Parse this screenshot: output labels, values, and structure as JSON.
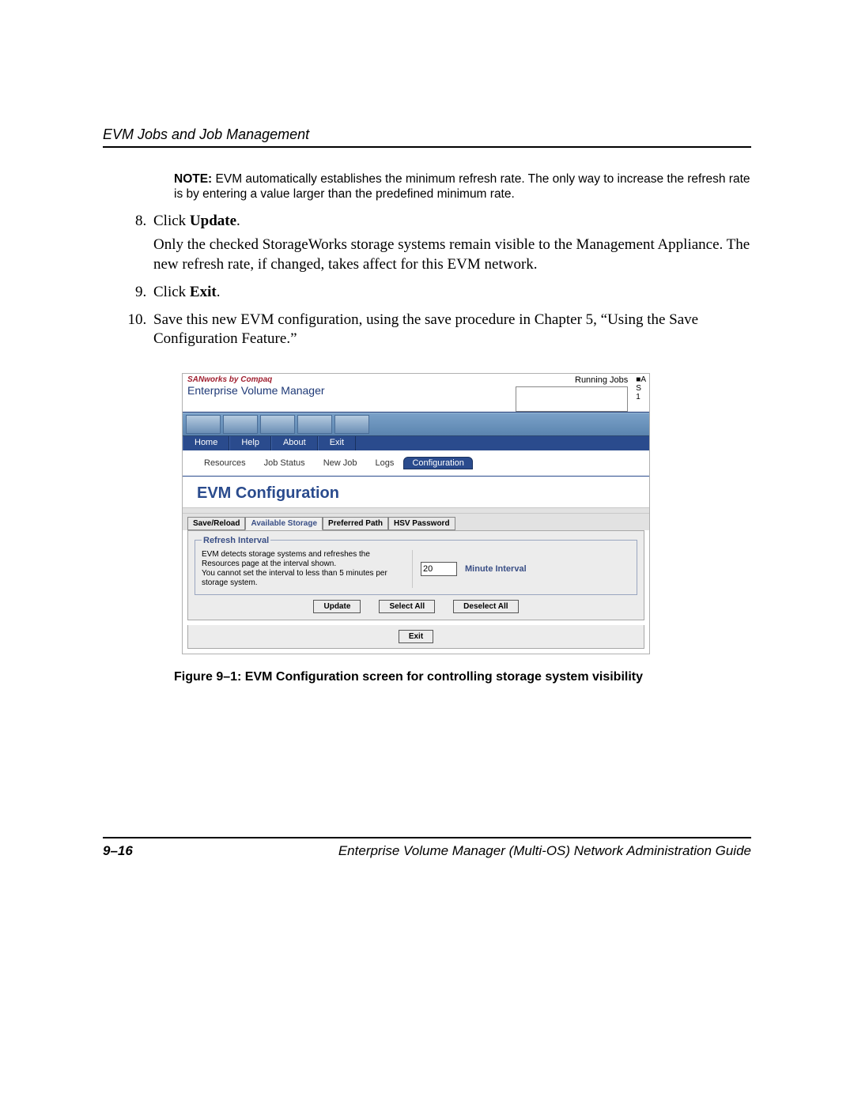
{
  "header": {
    "running_title": "EVM Jobs and Job Management"
  },
  "note": {
    "label": "NOTE:",
    "text": "EVM automatically establishes the minimum refresh rate. The only way to increase the refresh rate is by entering a value larger than the predefined minimum rate."
  },
  "steps": {
    "s8a": "Click ",
    "s8b": "Update",
    "s8c": ".",
    "s8_sub": "Only the checked StorageWorks storage systems remain visible to the Management Appliance. The new refresh rate, if changed, takes affect for this EVM network.",
    "s9a": "Click ",
    "s9b": "Exit",
    "s9c": ".",
    "s10": "Save this new EVM configuration, using the save procedure in Chapter 5, “Using the Save Configuration Feature.”"
  },
  "shot": {
    "brand_line1": "SANworks by Compaq",
    "brand_line2": "Enterprise Volume Manager",
    "running_label": "Running Jobs",
    "corner": {
      "l1": "■A",
      "l2": "S",
      "l3": "1"
    },
    "menu": {
      "m1": "Home",
      "m2": "Help",
      "m3": "About",
      "m4": "Exit"
    },
    "tabs": {
      "t1": "Resources",
      "t2": "Job Status",
      "t3": "New Job",
      "t4": "Logs",
      "t5": "Configuration"
    },
    "pane_title": "EVM Configuration",
    "subtabs": {
      "s1": "Save/Reload",
      "s2": "Available Storage",
      "s3": "Preferred Path",
      "s4": "HSV Password"
    },
    "legend": "Refresh Interval",
    "refresh_text": "EVM detects storage systems and refreshes the Resources page at the interval shown.\nYou cannot set the interval to less than 5 minutes per storage system.",
    "interval_value": "20",
    "interval_label": "Minute Interval",
    "btn_update": "Update",
    "btn_selectall": "Select All",
    "btn_deselectall": "Deselect All",
    "btn_exit": "Exit"
  },
  "caption": "Figure 9–1:  EVM Configuration screen for controlling storage system visibility",
  "footer": {
    "page_number": "9–16",
    "doc_title": "Enterprise Volume Manager (Multi-OS) Network Administration Guide"
  }
}
